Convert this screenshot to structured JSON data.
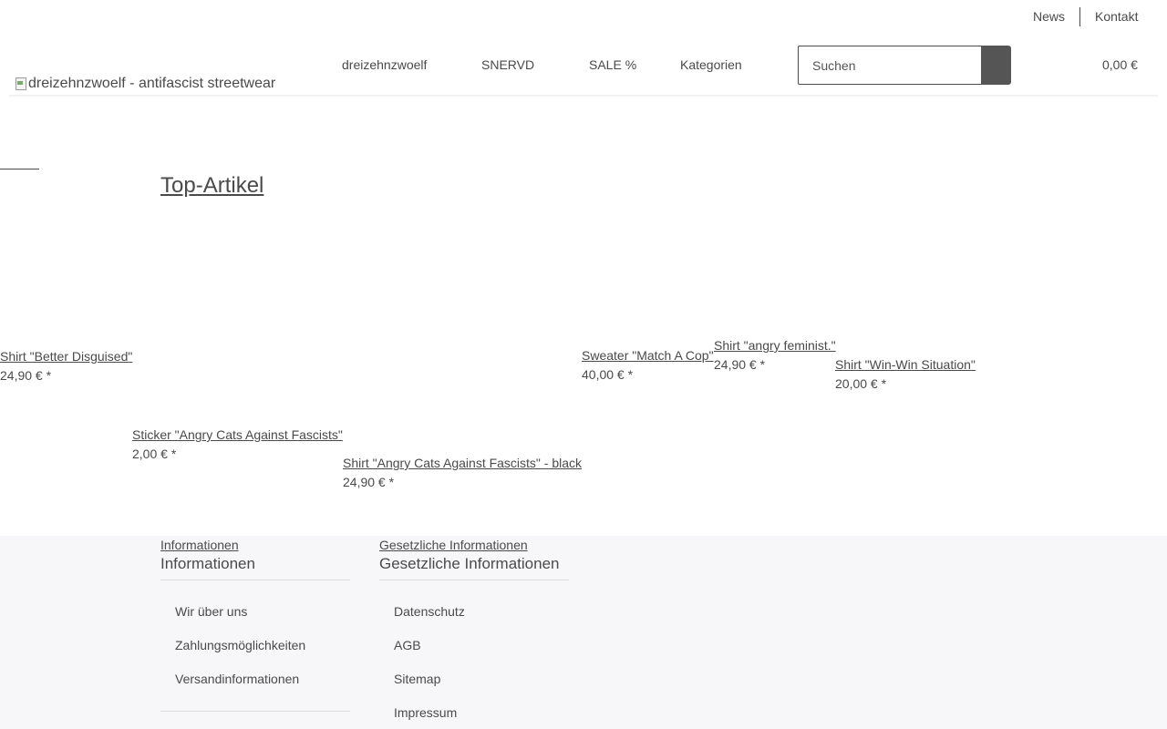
{
  "topbar": {
    "news": "News",
    "kontakt": "Kontakt"
  },
  "header": {
    "logo_alt": "dreizehnzwoelf - antifascist streetwear",
    "nav": [
      "dreizehnzwoelf",
      "SNERVD",
      "SALE %",
      "Kategorien"
    ],
    "search_placeholder": "Suchen",
    "cart_total": "0,00 €"
  },
  "main": {
    "heading": "Top-Artikel",
    "products": [
      {
        "name": "Shirt \"Better Disguised\"",
        "price": "24,90 € *"
      },
      {
        "name": "Sticker \"Angry Cats Against Fascists\"",
        "price": "2,00 € *"
      },
      {
        "name": "Shirt \"Angry Cats Against Fascists\" - black",
        "price": "24,90 € *"
      },
      {
        "name": "Sweater \"Match A Cop\"",
        "price": "40,00 € *"
      },
      {
        "name": "Shirt \"angry feminist.\"",
        "price": "24,90 € *"
      },
      {
        "name": "Shirt \"Win-Win Situation\"",
        "price": "20,00 € *"
      }
    ]
  },
  "footer": {
    "col1": {
      "link_heading": "Informationen ",
      "title": "Informationen",
      "items": [
        "Wir über uns",
        "Zahlungsmöglichkeiten",
        "Versandinformationen"
      ]
    },
    "col2": {
      "link_heading": "Gesetzliche Informationen ",
      "title": "Gesetzliche Informationen",
      "items": [
        "Datenschutz",
        "AGB",
        "Sitemap",
        "Impressum"
      ]
    }
  }
}
